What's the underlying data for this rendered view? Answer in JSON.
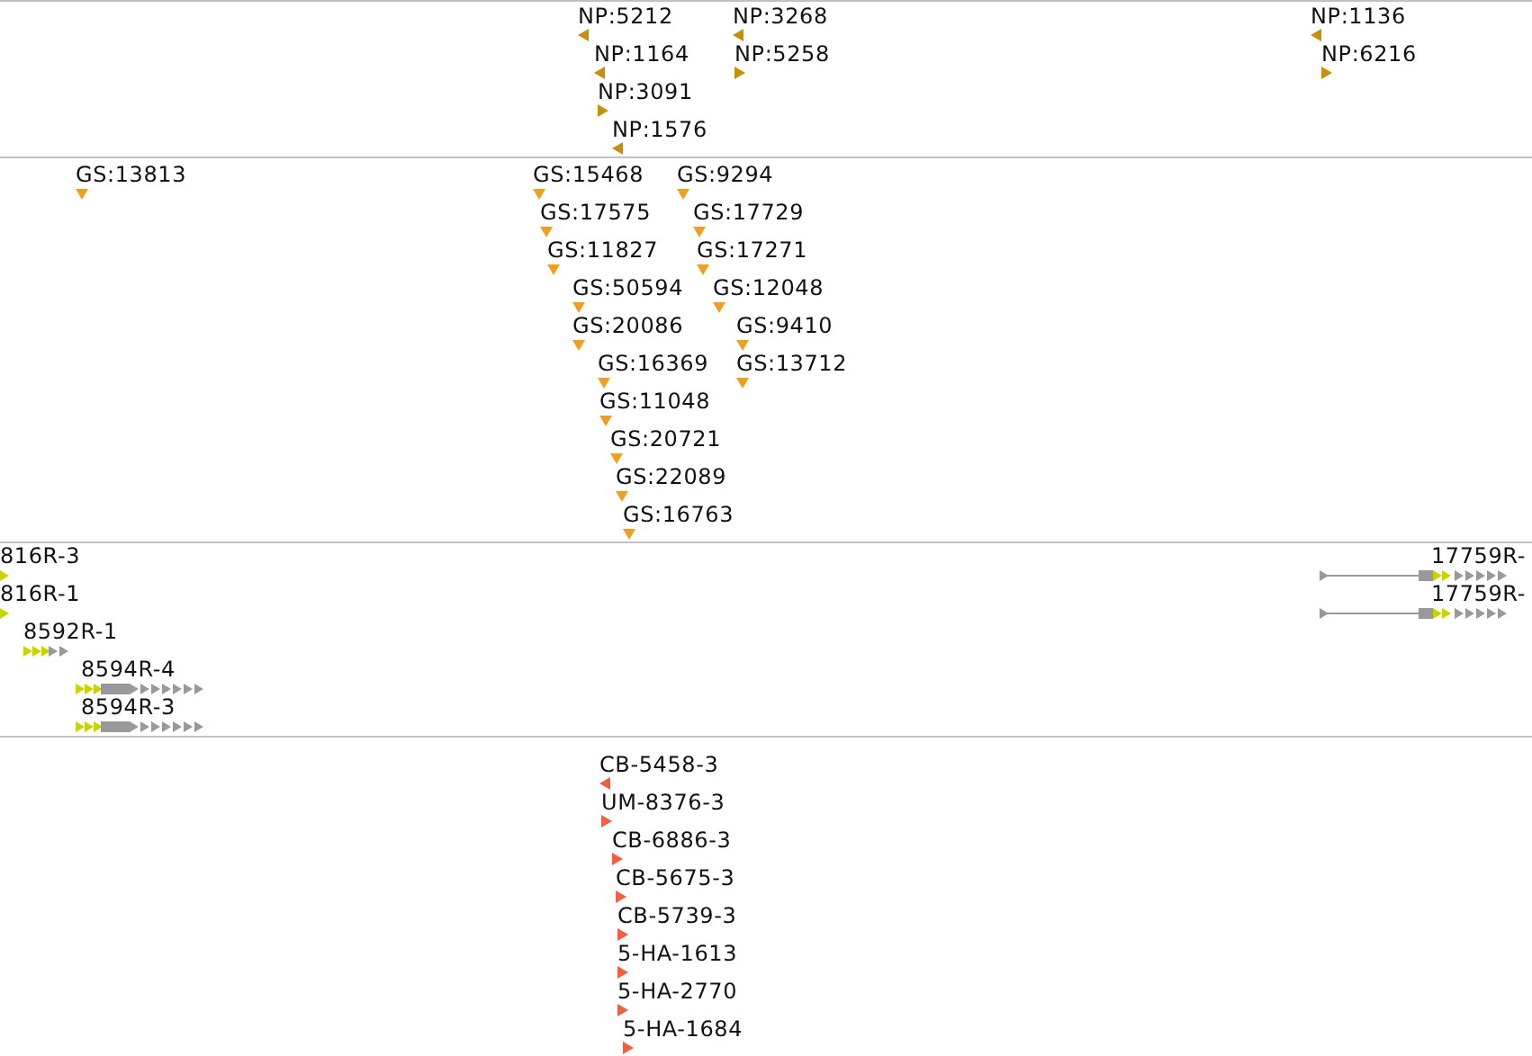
{
  "tracks": [
    {
      "kind": "oriented",
      "color": "#c8900a",
      "features": [
        {
          "label": "NP:5212",
          "reverse": true
        },
        {
          "label": "NP:3268",
          "reverse": true
        },
        {
          "label": "NP:1136",
          "reverse": true
        },
        {
          "label": "NP:1164",
          "reverse": true
        },
        {
          "label": "NP:5258",
          "reverse": false
        },
        {
          "label": "NP:6216",
          "reverse": false
        },
        {
          "label": "NP:3091",
          "reverse": false
        },
        {
          "label": "NP:1576",
          "reverse": true
        }
      ]
    },
    {
      "kind": "site",
      "color": "#f0a020",
      "features": [
        {
          "label": "GS:13813"
        },
        {
          "label": "GS:15468"
        },
        {
          "label": "GS:9294"
        },
        {
          "label": "GS:17575"
        },
        {
          "label": "GS:17729"
        },
        {
          "label": "GS:11827"
        },
        {
          "label": "GS:17271"
        },
        {
          "label": "GS:50594"
        },
        {
          "label": "GS:12048"
        },
        {
          "label": "GS:20086"
        },
        {
          "label": "GS:9410"
        },
        {
          "label": "GS:16369"
        },
        {
          "label": "GS:13712"
        },
        {
          "label": "GS:11048"
        },
        {
          "label": "GS:20721"
        },
        {
          "label": "GS:22089"
        },
        {
          "label": "GS:16763"
        }
      ]
    },
    {
      "kind": "gene",
      "color": "#c8d400",
      "features": [
        {
          "label": "816R-3"
        },
        {
          "label": "17759R-"
        },
        {
          "label": "816R-1"
        },
        {
          "label": "17759R-"
        },
        {
          "label": "8592R-1"
        },
        {
          "label": "8594R-4"
        },
        {
          "label": "8594R-3"
        }
      ]
    },
    {
      "kind": "oriented",
      "color": "#f06040",
      "features": [
        {
          "label": "CB-5458-3",
          "reverse": true
        },
        {
          "label": "UM-8376-3",
          "reverse": false
        },
        {
          "label": "CB-6886-3",
          "reverse": false
        },
        {
          "label": "CB-5675-3",
          "reverse": false
        },
        {
          "label": "CB-5739-3",
          "reverse": false
        },
        {
          "label": "5-HA-1613",
          "reverse": false
        },
        {
          "label": "5-HA-2770",
          "reverse": false
        },
        {
          "label": "5-HA-1684",
          "reverse": false
        }
      ]
    }
  ]
}
